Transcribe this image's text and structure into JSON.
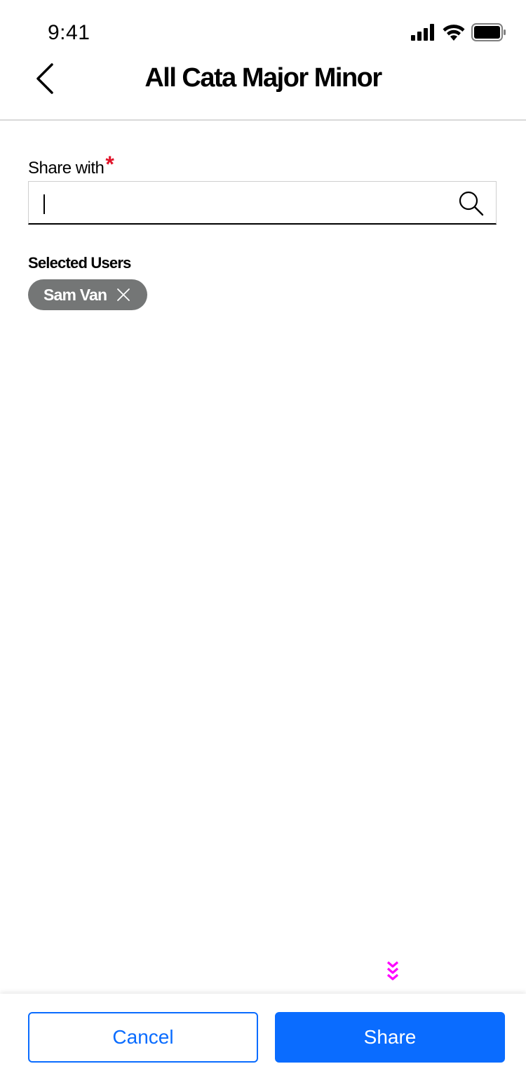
{
  "status_bar": {
    "time": "9:41"
  },
  "header": {
    "title": "All Cata Major Minor",
    "back_icon": "chevron-left-icon"
  },
  "form": {
    "share_label": "Share with",
    "required_marker": "*",
    "search": {
      "value": "",
      "placeholder": "",
      "icon": "search-icon"
    },
    "selected_users_label": "Selected Users",
    "selected_users": [
      {
        "name": "Sam Van",
        "remove_icon": "close-icon"
      }
    ]
  },
  "footer": {
    "cancel_label": "Cancel",
    "share_label": "Share"
  },
  "colors": {
    "accent": "#0a6cff",
    "required": "#e0142a",
    "chip_bg": "#747676",
    "scroll_indicator": "#ff00ff"
  }
}
